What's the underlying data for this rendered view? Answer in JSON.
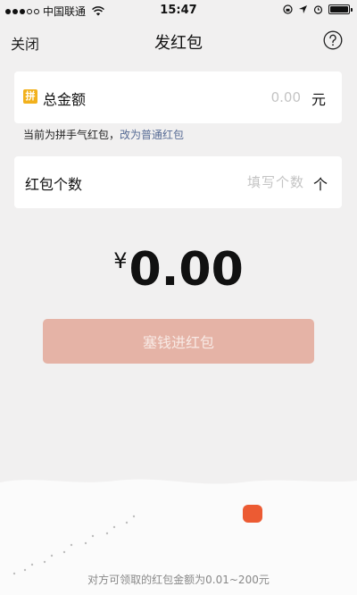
{
  "status_bar": {
    "carrier": "中国联通",
    "time": "15:47"
  },
  "nav": {
    "close_label": "关闭",
    "title": "发红包",
    "help_icon": "question-circle-icon"
  },
  "amount_card": {
    "badge": "拼",
    "label": "总金额",
    "placeholder": "0.00",
    "unit": "元"
  },
  "hint": {
    "text": "当前为拼手气红包，",
    "link": "改为普通红包"
  },
  "count_card": {
    "label": "红包个数",
    "placeholder": "填写个数",
    "unit": "个"
  },
  "total": {
    "currency": "¥",
    "value": "0.00"
  },
  "submit": {
    "label": "塞钱进红包"
  },
  "footer": {
    "text": "对方可领取的红包金额为0.01~200元"
  },
  "colors": {
    "background": "#f1f0f0",
    "button": "#e5b3a6",
    "link": "#576b95",
    "badge": "#f2b11c",
    "lantern": "#ec5b33"
  }
}
